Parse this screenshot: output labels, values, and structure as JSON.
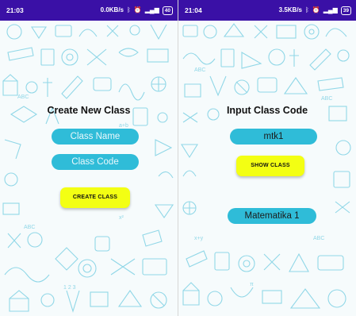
{
  "left_screen": {
    "status_bar": {
      "time": "21:03",
      "net_speed": "0.0KB/s",
      "battery": "40"
    },
    "title": "Create New Class",
    "class_name_input": {
      "placeholder": "Class Name",
      "value": ""
    },
    "class_code_input": {
      "placeholder": "Class Code",
      "value": ""
    },
    "create_button_label": "CREATE CLASS"
  },
  "right_screen": {
    "status_bar": {
      "time": "21:04",
      "net_speed": "3.5KB/s",
      "battery": "39"
    },
    "title": "Input Class Code",
    "class_code_input": {
      "placeholder": "",
      "value": "mtk1"
    },
    "show_button_label": "SHOW CLASS",
    "result_class_name": "Matematika 1"
  },
  "colors": {
    "status_bar": "#3a10a6",
    "pill": "#2fbcd8",
    "button": "#f3ff13",
    "doodle": "#6fcbe0"
  },
  "icons": [
    "bluetooth-icon",
    "alarm-icon",
    "signal-icon",
    "battery-icon"
  ]
}
